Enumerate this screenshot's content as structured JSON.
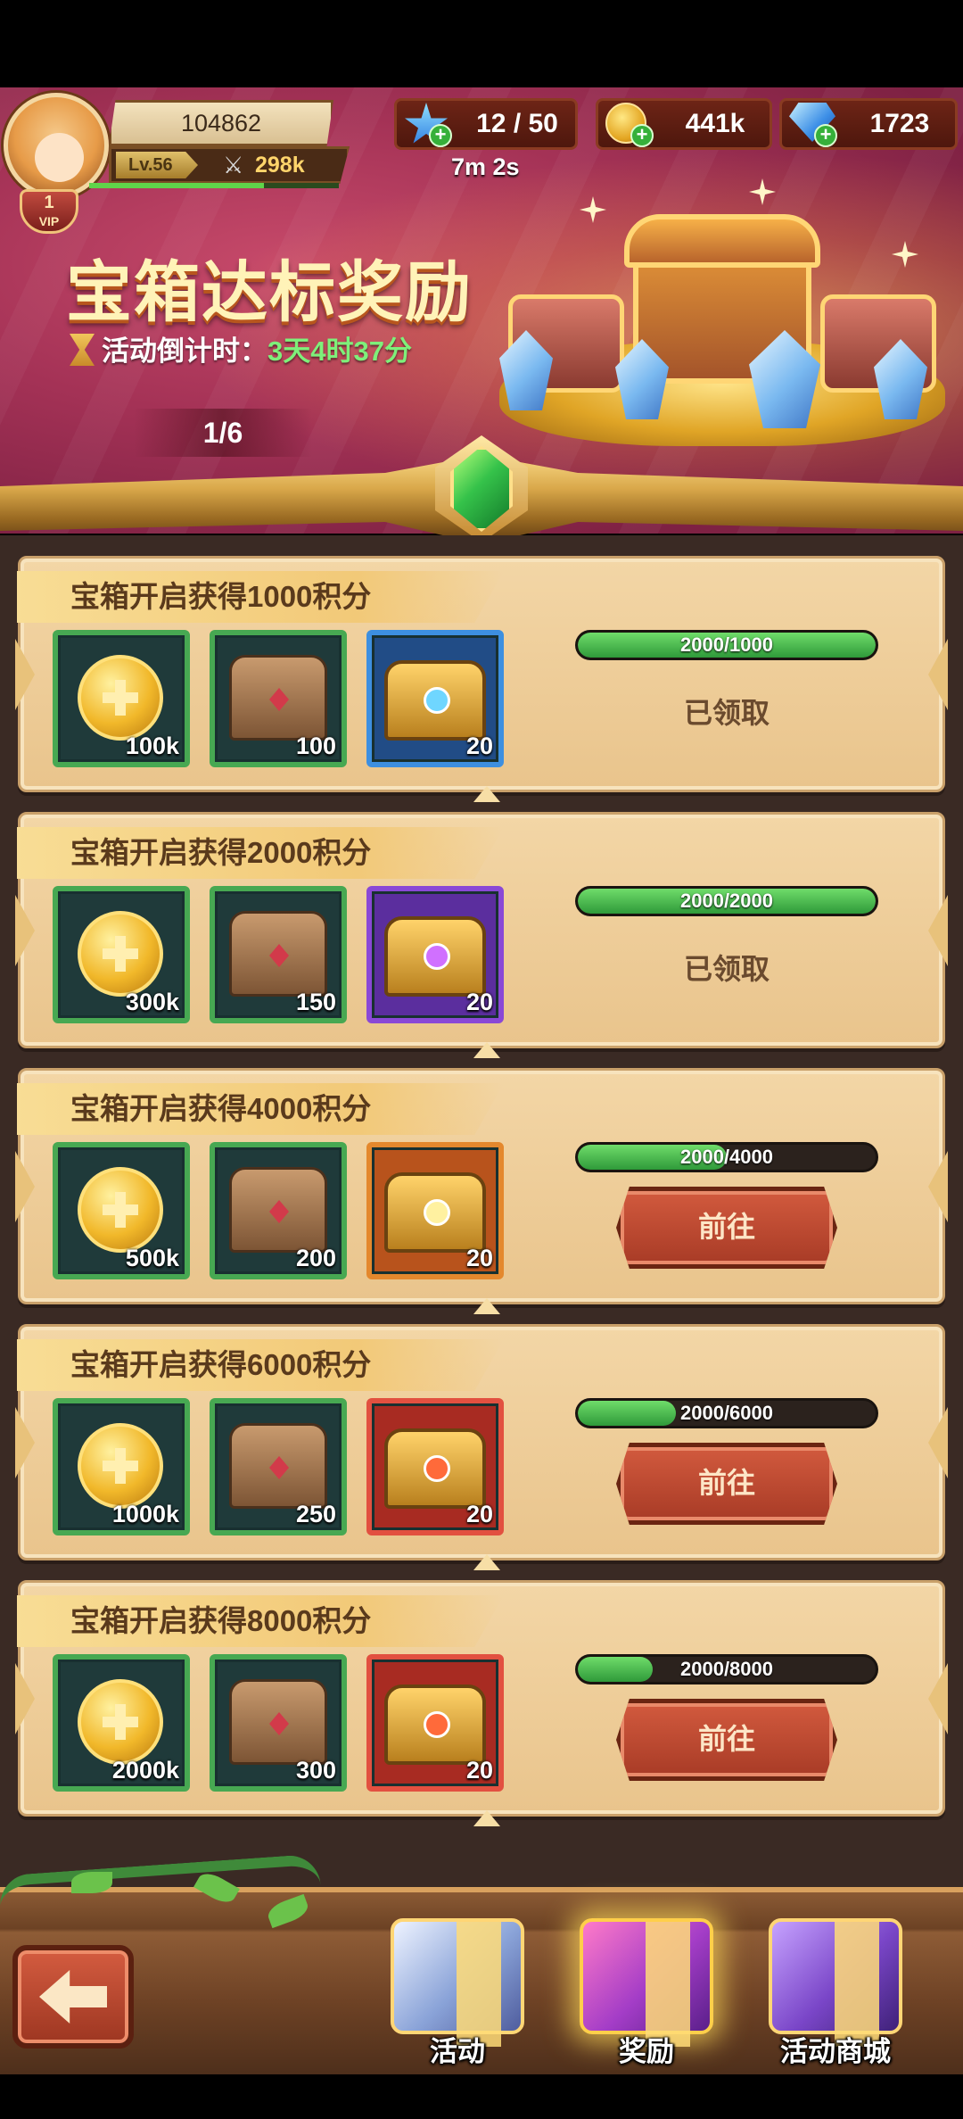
{
  "player": {
    "id": "104862",
    "level": "Lv.56",
    "power": "298k",
    "vip_level": "1",
    "vip_label": "VIP"
  },
  "currencies": {
    "stamina": "12 / 50",
    "stamina_timer": "7m 2s",
    "gold": "441k",
    "diamonds": "1723"
  },
  "banner": {
    "title": "宝箱达标奖励",
    "countdown_label": "活动倒计时：",
    "countdown_value": "3天4时37分",
    "page_indicator": "1/6"
  },
  "tiers": [
    {
      "header": "宝箱开启获得1000积分",
      "rewards": [
        {
          "type": "coin",
          "qty": "100k",
          "rarity": "green"
        },
        {
          "type": "wood-chest",
          "qty": "100",
          "rarity": "green"
        },
        {
          "type": "fancy-chest",
          "qty": "20",
          "rarity": "blue"
        }
      ],
      "progress_text": "2000/1000",
      "progress": 1.0,
      "status": "已领取",
      "claimed": true
    },
    {
      "header": "宝箱开启获得2000积分",
      "rewards": [
        {
          "type": "coin",
          "qty": "300k",
          "rarity": "green"
        },
        {
          "type": "wood-chest",
          "qty": "150",
          "rarity": "green"
        },
        {
          "type": "fancy-chest",
          "qty": "20",
          "rarity": "purple"
        }
      ],
      "progress_text": "2000/2000",
      "progress": 1.0,
      "status": "已领取",
      "claimed": true
    },
    {
      "header": "宝箱开启获得4000积分",
      "rewards": [
        {
          "type": "coin",
          "qty": "500k",
          "rarity": "green"
        },
        {
          "type": "wood-chest",
          "qty": "200",
          "rarity": "green"
        },
        {
          "type": "fancy-chest",
          "qty": "20",
          "rarity": "orange"
        }
      ],
      "progress_text": "2000/4000",
      "progress": 0.5,
      "status": "前往",
      "claimed": false
    },
    {
      "header": "宝箱开启获得6000积分",
      "rewards": [
        {
          "type": "coin",
          "qty": "1000k",
          "rarity": "green"
        },
        {
          "type": "wood-chest",
          "qty": "250",
          "rarity": "green"
        },
        {
          "type": "fancy-chest",
          "qty": "20",
          "rarity": "red"
        }
      ],
      "progress_text": "2000/6000",
      "progress": 0.333,
      "status": "前往",
      "claimed": false
    },
    {
      "header": "宝箱开启获得8000积分",
      "rewards": [
        {
          "type": "coin",
          "qty": "2000k",
          "rarity": "green"
        },
        {
          "type": "wood-chest",
          "qty": "300",
          "rarity": "green"
        },
        {
          "type": "fancy-chest",
          "qty": "20",
          "rarity": "red"
        }
      ],
      "progress_text": "2000/8000",
      "progress": 0.25,
      "status": "前往",
      "claimed": false
    }
  ],
  "bottom_nav": {
    "tabs": [
      {
        "label": "活动",
        "icon": "gift-box-icon",
        "active": false
      },
      {
        "label": "奖励",
        "icon": "gift-box-icon",
        "active": true
      },
      {
        "label": "活动商城",
        "icon": "treasure-shop-icon",
        "active": false
      }
    ],
    "back_icon": "back-arrow-icon"
  },
  "colors": {
    "progress_fill": "#2f9a3a",
    "go_button": "#a83b26",
    "countdown_value": "#7ef07a",
    "rarity_green": "#47a852",
    "rarity_blue": "#3d8fe0",
    "rarity_purple": "#8a48d6",
    "rarity_orange": "#e4882d",
    "rarity_red": "#e25040"
  }
}
